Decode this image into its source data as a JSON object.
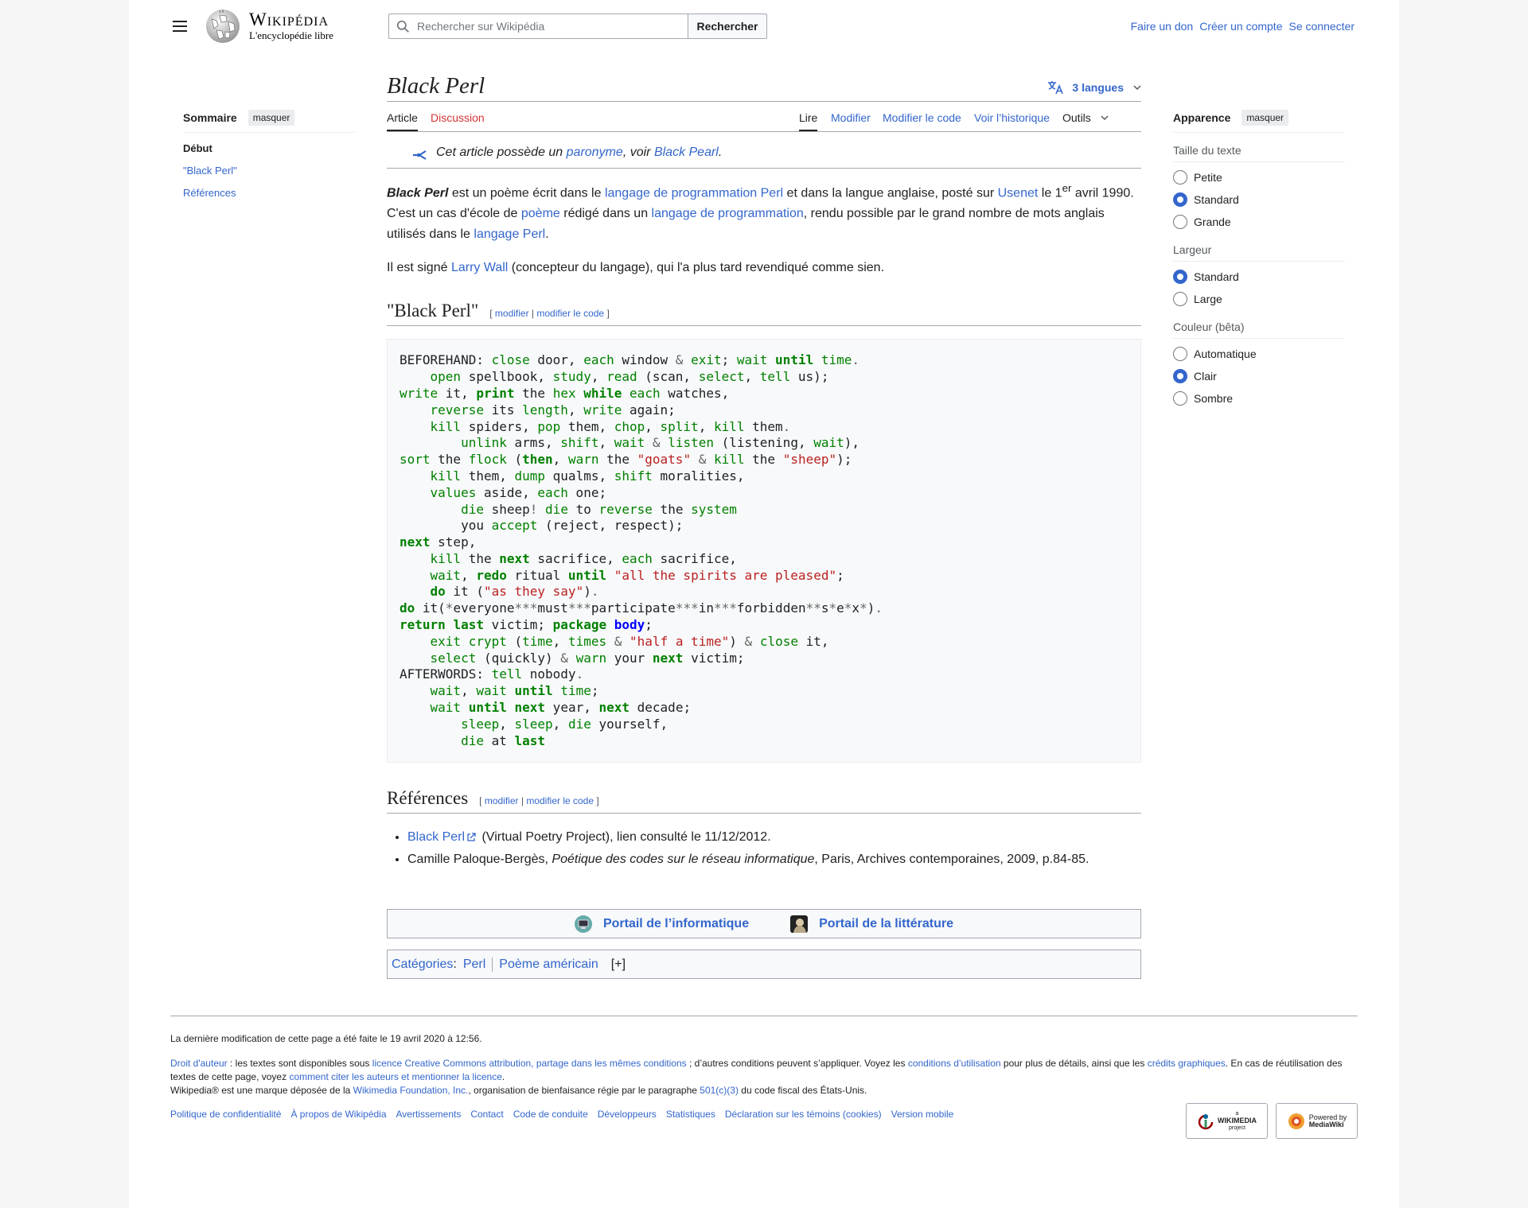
{
  "header": {
    "logo_title": "Wikipédia",
    "logo_tagline": "L'encyclopédie libre",
    "search_placeholder": "Rechercher sur Wikipédia",
    "search_button": "Rechercher",
    "user_links": [
      "Faire un don",
      "Créer un compte",
      "Se connecter"
    ]
  },
  "toc": {
    "title": "Sommaire",
    "hide": "masquer",
    "items": [
      "Début",
      "\"Black Perl\"",
      "Références"
    ]
  },
  "article": {
    "title": "Black Perl",
    "languages": "3 langues",
    "tabs_left": [
      "Article",
      "Discussion"
    ],
    "tabs_right": [
      "Lire",
      "Modifier",
      "Modifier le code",
      "Voir l’historique",
      "Outils"
    ],
    "hatnote": {
      "pre": "Cet article possède un ",
      "link1": "paronyme",
      "mid": ", voir ",
      "link2": "Black Pearl",
      "post": "."
    },
    "p1": {
      "b": "Black Perl",
      "t1": " est un poème écrit dans le ",
      "l1": "langage de programmation Perl",
      "t2": " et dans la langue anglaise, posté sur ",
      "l2": "Usenet",
      "t3": " le 1",
      "sup": "er",
      "t4": " avril 1990. C'est un cas d'école de ",
      "l3": "poème",
      "t5": " rédigé dans un ",
      "l4": "langage de programmation",
      "t6": ", rendu possible par le grand nombre de mots anglais utilisés dans le ",
      "l5": "langage Perl",
      "t7": "."
    },
    "p2": {
      "t1": "Il est signé ",
      "l1": "Larry Wall",
      "t2": " (concepteur du langage), qui l'a plus tard revendiqué comme sien."
    },
    "section1": "\"Black Perl\"",
    "edit": {
      "open": "[ ",
      "modifier": "modifier",
      "sep": " | ",
      "code": "modifier le code",
      "close": " ]"
    },
    "section2": "Références",
    "refs": [
      {
        "link": "Black Perl",
        "text": " (Virtual Poetry Project), lien consulté le 11/12/2012."
      },
      {
        "pre": "Camille Paloque-Bergès, ",
        "italic": "Poétique des codes sur le réseau informatique",
        "post": ", Paris, Archives contemporaines, 2009, p.84-85."
      }
    ],
    "portals": [
      "Portail de l’informatique",
      "Portail de la littérature"
    ],
    "categories": {
      "label": "Catégories",
      "colon": " :",
      "items": [
        "Perl",
        "Poème américain"
      ],
      "more": "[+]"
    }
  },
  "appearance": {
    "title": "Apparence",
    "hide": "masquer",
    "text_size": {
      "label": "Taille du texte",
      "options": [
        "Petite",
        "Standard",
        "Grande"
      ],
      "selected": 1
    },
    "width": {
      "label": "Largeur",
      "options": [
        "Standard",
        "Large"
      ],
      "selected": 0
    },
    "color": {
      "label": "Couleur (bêta)",
      "options": [
        "Automatique",
        "Clair",
        "Sombre"
      ],
      "selected": 1
    }
  },
  "footer": {
    "lastmod": "La dernière modification de cette page a été faite le 19 avril 2020 à 12:56.",
    "lic": {
      "l1": "Droit d'auteur",
      "t1": " : les textes sont disponibles sous ",
      "l2": "licence Creative Commons attribution, partage dans les mêmes conditions",
      "t2": " ; d’autres conditions peuvent s’appliquer. Voyez les ",
      "l3": "conditions d’utilisation",
      "t3": " pour plus de détails, ainsi que les ",
      "l4": "crédits graphiques",
      "t4": ". En cas de réutilisation des textes de cette page, voyez ",
      "l5": "comment citer les auteurs et mentionner la licence",
      "t5": "."
    },
    "tm": {
      "t1": "Wikipedia® est une marque déposée de la ",
      "l1": "Wikimedia Foundation, Inc.",
      "t2": ", organisation de bienfaisance régie par le paragraphe ",
      "l2": "501(c)(3)",
      "t3": " du code fiscal des États-Unis."
    },
    "links": [
      "Politique de confidentialité",
      "À propos de Wikipédia",
      "Avertissements",
      "Contact",
      "Code de conduite",
      "Développeurs",
      "Statistiques",
      "Déclaration sur les témoins (cookies)",
      "Version mobile"
    ],
    "badge1": {
      "a": "a",
      "b": "WIKIMEDIA",
      "c": "project"
    },
    "badge2": {
      "a": "Powered by",
      "b": "MediaWiki"
    }
  }
}
